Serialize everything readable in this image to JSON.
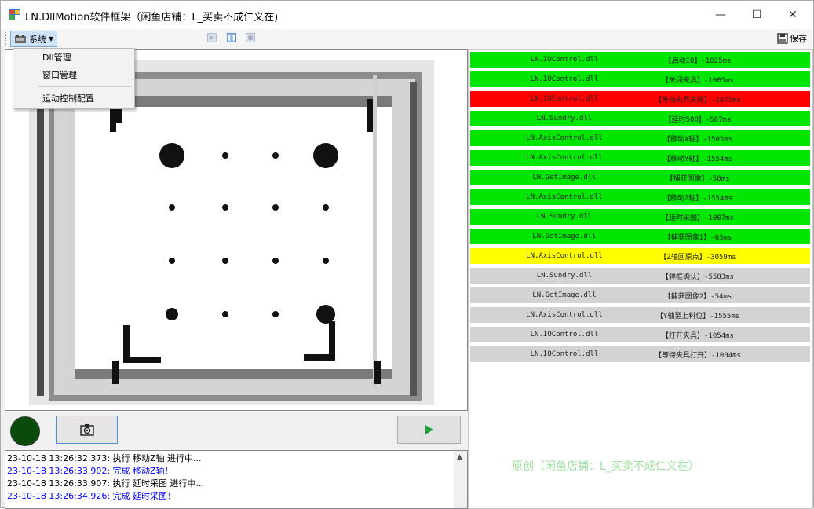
{
  "window": {
    "title": "LN.DllMotion软件框架（闲鱼店铺：L_买卖不成仁义在)",
    "minimize_glyph": "—",
    "maximize_glyph": "☐",
    "close_glyph": "✕"
  },
  "toolbar": {
    "system_menu_label": "系统",
    "save_label": "保存"
  },
  "system_menu": {
    "items": [
      "Dll管理",
      "窗口管理",
      "运动控制配置"
    ]
  },
  "steps": [
    {
      "dll": "LN.IOControl.dll",
      "action": "【启动IO】-1025ms",
      "color": "#00e600"
    },
    {
      "dll": "LN.IOControl.dll",
      "action": "【关闭夹具】-1005ms",
      "color": "#00e600"
    },
    {
      "dll": "LN.IOControl.dll",
      "action": "【等待夹具关闭】-1075ms",
      "color": "#ff0000"
    },
    {
      "dll": "LN.Sundry.dll",
      "action": "【延时500】-507ms",
      "color": "#00e600"
    },
    {
      "dll": "LN.AxisControl.dll",
      "action": "【移动X轴】-1505ms",
      "color": "#00e600"
    },
    {
      "dll": "LN.AxisControl.dll",
      "action": "【移动Y轴】-1554ms",
      "color": "#00e600"
    },
    {
      "dll": "LN.GetImage.dll",
      "action": "【捕获图像】-58ms",
      "color": "#00e600"
    },
    {
      "dll": "LN.AxisControl.dll",
      "action": "【移动Z轴】-1554ms",
      "color": "#00e600"
    },
    {
      "dll": "LN.Sundry.dll",
      "action": "【延时采图】-1007ms",
      "color": "#00e600"
    },
    {
      "dll": "LN.GetImage.dll",
      "action": "【捕获图像1】-63ms",
      "color": "#00e600"
    },
    {
      "dll": "LN.AxisControl.dll",
      "action": "【Z轴回原点】-3059ms",
      "color": "#ffff00"
    },
    {
      "dll": "LN.Sundry.dll",
      "action": "【弹框确认】-5583ms",
      "color": "#d3d3d3"
    },
    {
      "dll": "LN.GetImage.dll",
      "action": "【捕获图像2】-54ms",
      "color": "#d3d3d3"
    },
    {
      "dll": "LN.AxisControl.dll",
      "action": "【Y轴至上料位】-1555ms",
      "color": "#d3d3d3"
    },
    {
      "dll": "LN.IOControl.dll",
      "action": "【打开夹具】-1054ms",
      "color": "#d3d3d3"
    },
    {
      "dll": "LN.IOControl.dll",
      "action": "【等待夹具打开】-1004ms",
      "color": "#d3d3d3"
    }
  ],
  "watermark": "原创（闲鱼店铺：L_买卖不成仁义在）",
  "log": [
    {
      "text": "23-10-18 13:26:32.373: 执行 移动Z轴 进行中...",
      "color": "#000000"
    },
    {
      "text": "23-10-18 13:26:33.902: 完成 移动Z轴！",
      "color": "#0000ff"
    },
    {
      "text": "23-10-18 13:26:33.907: 执行 延时采图 进行中...",
      "color": "#000000"
    },
    {
      "text": "23-10-18 13:26:34.926: 完成 延时采图！",
      "color": "#0000ff"
    }
  ],
  "colors": {
    "status_led": "#0a4a0a",
    "accent": "#4a8fd6"
  },
  "icons": {
    "app": "app-grid-icon",
    "system": "gear-device-icon",
    "save": "floppy-save-icon",
    "snapshot": "camera-icon",
    "play": "play-triangle-icon"
  }
}
